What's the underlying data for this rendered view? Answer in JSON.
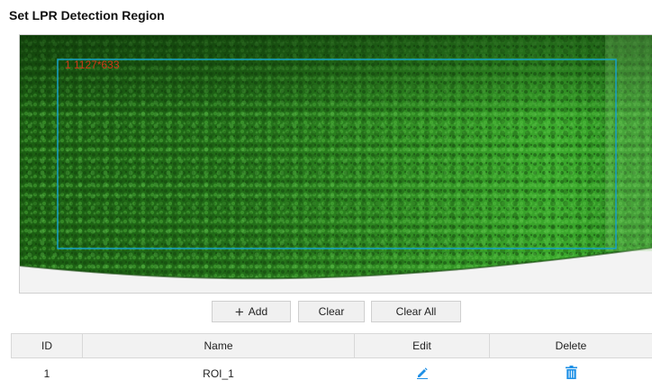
{
  "page": {
    "title": "Set LPR Detection Region"
  },
  "video": {
    "roi_label": "1 1127*633",
    "roi_color": "#16a3c9",
    "roi_label_color": "#d03a1a"
  },
  "toolbar": {
    "add_label": "Add",
    "add_icon": "plus-icon",
    "clear_label": "Clear",
    "clear_all_label": "Clear All"
  },
  "table": {
    "headers": {
      "id": "ID",
      "name": "Name",
      "edit": "Edit",
      "delete": "Delete"
    },
    "rows": [
      {
        "id": "1",
        "name": "ROI_1",
        "edit_icon": "pencil-icon",
        "delete_icon": "trash-icon"
      }
    ]
  },
  "colors": {
    "icon_accent": "#1e90e6"
  }
}
